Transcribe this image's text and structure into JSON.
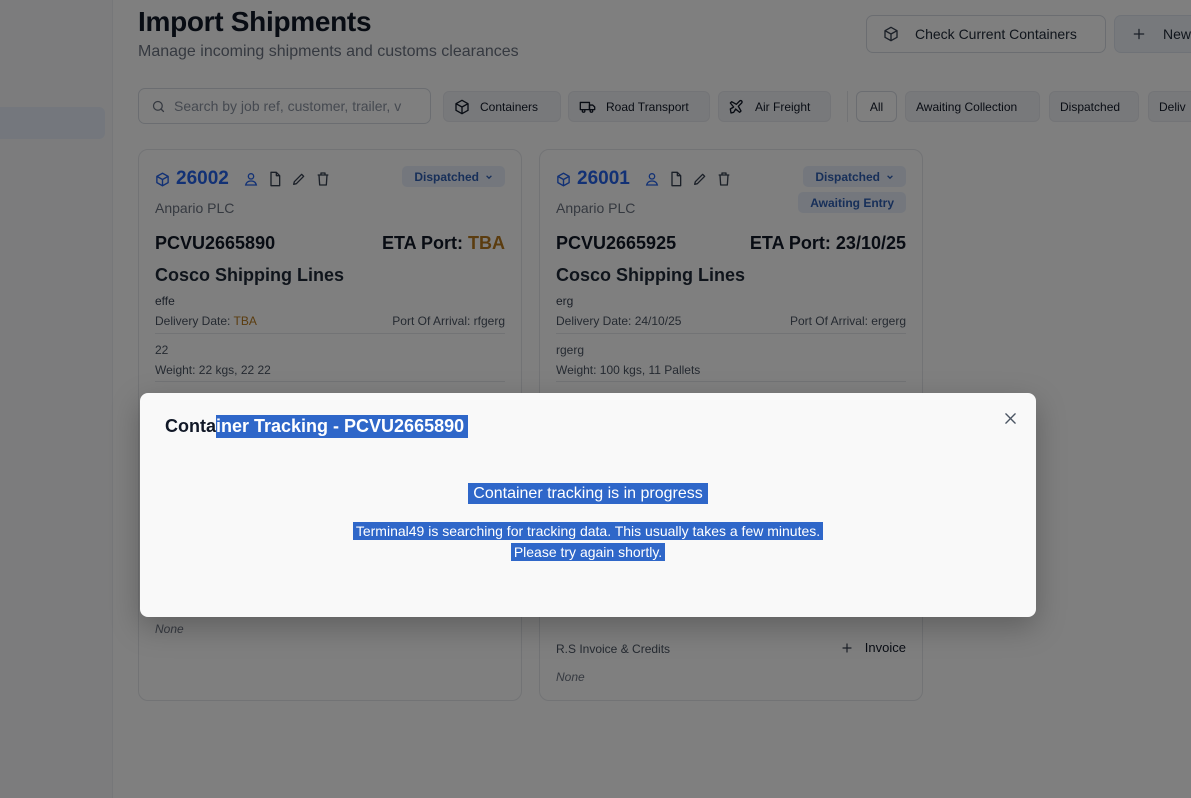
{
  "page": {
    "title": "Import Shipments",
    "subtitle": "Manage incoming shipments and customs clearances"
  },
  "header_actions": {
    "check_containers_label": "Check Current Containers",
    "new_label": "New"
  },
  "search": {
    "placeholder": "Search by job ref, customer, trailer, v"
  },
  "type_filters": [
    {
      "label": "Containers",
      "icon": "container-box-icon"
    },
    {
      "label": "Road Transport",
      "icon": "truck-icon"
    },
    {
      "label": "Air Freight",
      "icon": "plane-icon"
    }
  ],
  "status_filters": [
    "All",
    "Awaiting Collection",
    "Dispatched",
    "Deliv"
  ],
  "cards": [
    {
      "job_ref": "26002",
      "customer": "Anpario PLC",
      "status": "Dispatched",
      "extra_status": "",
      "container_no": "PCVU2665890",
      "eta_label": "ETA Port:",
      "eta_value": "TBA",
      "shipping_line": "Cosco Shipping Lines",
      "description": "effe",
      "delivery_date_label": "Delivery Date:",
      "delivery_date": "TBA",
      "port_of_arrival": "Port Of Arrival: rfgerg",
      "packages": "22",
      "weight": "Weight: 22 kgs, 22 22",
      "invoice_label": "",
      "invoice_none": "None"
    },
    {
      "job_ref": "26001",
      "customer": "Anpario PLC",
      "status": "Dispatched",
      "extra_status": "Awaiting Entry",
      "container_no": "PCVU2665925",
      "eta_label": "ETA Port:",
      "eta_value": "23/10/25",
      "shipping_line": "Cosco Shipping Lines",
      "description": "erg",
      "delivery_date_label": "Delivery Date:",
      "delivery_date": "24/10/25",
      "port_of_arrival": "Port Of Arrival: ergerg",
      "packages": "rgerg",
      "weight": "Weight: 100 kgs, 11 Pallets",
      "invoice_label": "R.S Invoice & Credits",
      "invoice_button": "Invoice",
      "invoice_none": "None"
    }
  ],
  "modal": {
    "title_prefix": "Conta",
    "title_selected": "iner Tracking - PCVU2665890",
    "heading": "Container tracking is in progress",
    "body_line1": "Terminal49 is searching for tracking data. This usually takes a few minutes.",
    "body_line2": "Please try again shortly."
  },
  "colors": {
    "accent": "#2563eb",
    "badge_bg": "#e8eefb",
    "tba": "#b7791f",
    "selection": "#2f67c9"
  }
}
